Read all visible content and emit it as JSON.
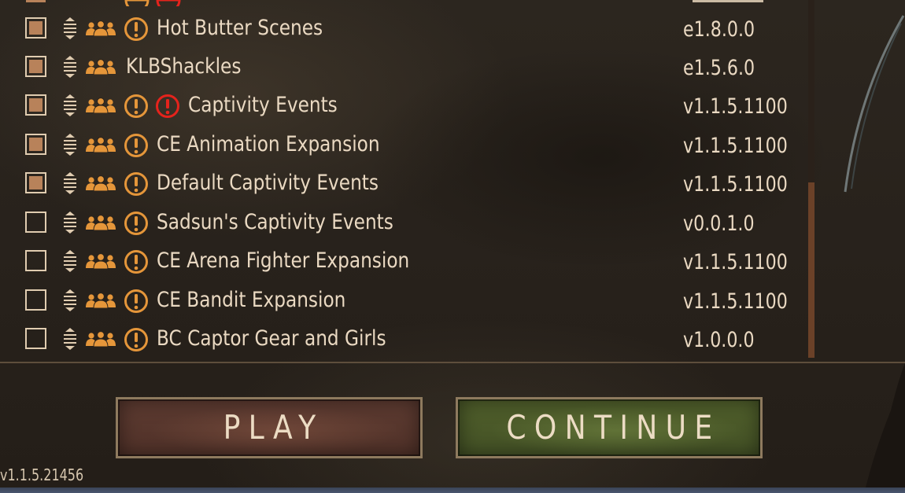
{
  "mods": [
    {
      "name": "Hot Butter Scenes",
      "version": "e1.8.0.0",
      "checked": true,
      "warnings": [
        "orange"
      ]
    },
    {
      "name": "KLBShackles",
      "version": "e1.5.6.0",
      "checked": true,
      "warnings": []
    },
    {
      "name": "Captivity Events",
      "version": "v1.1.5.1100",
      "checked": true,
      "warnings": [
        "orange",
        "red"
      ]
    },
    {
      "name": "CE Animation Expansion",
      "version": "v1.1.5.1100",
      "checked": true,
      "warnings": [
        "orange"
      ]
    },
    {
      "name": "Default Captivity Events",
      "version": "v1.1.5.1100",
      "checked": true,
      "warnings": [
        "orange"
      ]
    },
    {
      "name": "Sadsun's Captivity Events",
      "version": "v0.0.1.0",
      "checked": false,
      "warnings": [
        "orange"
      ]
    },
    {
      "name": "CE Arena Fighter Expansion",
      "version": "v1.1.5.1100",
      "checked": false,
      "warnings": [
        "orange"
      ]
    },
    {
      "name": "CE Bandit Expansion",
      "version": "v1.1.5.1100",
      "checked": false,
      "warnings": [
        "orange"
      ]
    },
    {
      "name": "BC Captor Gear and Girls",
      "version": "v1.0.0.0",
      "checked": false,
      "warnings": [
        "orange"
      ]
    }
  ],
  "icons": {
    "drag": "drag-handle-icon",
    "group": "multiplayer-group-icon",
    "warning": "warning-icon"
  },
  "buttons": {
    "play": "PLAY",
    "continue": "CONTINUE"
  },
  "game_version": "v1.1.5.21456",
  "colors": {
    "text": "#ead9c2",
    "icon_orange": "#e5963a",
    "warning_red": "#e5231c",
    "checkbox_fill": "#b8825a",
    "play_button": "#5a382e",
    "continue_button": "#4b5a29",
    "scrollbar": "#6b4128"
  }
}
